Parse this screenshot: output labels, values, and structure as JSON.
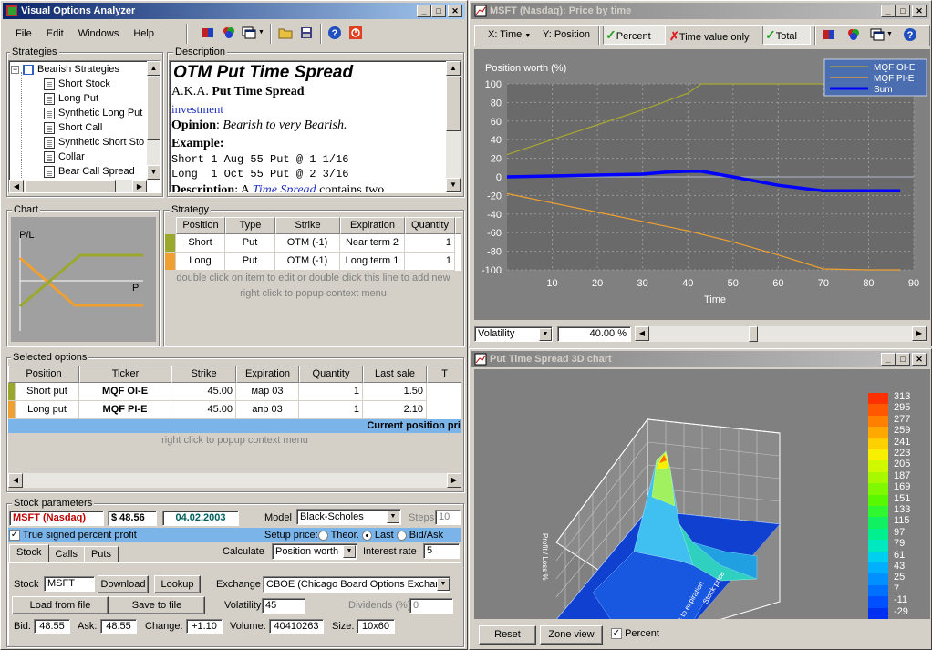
{
  "main": {
    "title": "Visual Options Analyzer",
    "menu": [
      "File",
      "Edit",
      "Windows",
      "Help"
    ]
  },
  "strategies": {
    "label": "Strategies",
    "root": "Bearish Strategies",
    "items": [
      "Short Stock",
      "Long Put",
      "Synthetic Long Put",
      "Short Call",
      "Synthetic Short Sto",
      "Collar",
      "Bear Call Spread"
    ]
  },
  "description": {
    "label": "Description",
    "heading": "OTM Put Time Spread",
    "aka_prefix": "A.K.A.",
    "aka": "Put Time Spread",
    "link": "investment",
    "opinion_label": "Opinion",
    "opinion": "Bearish to very Bearish.",
    "example_label": "Example:",
    "example_1": "Short 1 Aug 55 Put @ 1 1/16",
    "example_2": "Long  1 Oct 55 Put @ 2 3/16",
    "desc_label": "Description",
    "desc_prefix": ": A",
    "desc_link": "Time Spread",
    "desc_rest": "contains two"
  },
  "chart": {
    "label": "Chart",
    "pl": "P/L",
    "p": "P"
  },
  "strategy": {
    "label": "Strategy",
    "headers": [
      "Position",
      "Type",
      "Strike",
      "Expiration",
      "Quantity"
    ],
    "rows": [
      {
        "color": "#9aa82c",
        "cells": [
          "Short",
          "Put",
          "OTM (-1)",
          "Near term 2",
          "1"
        ]
      },
      {
        "color": "#f0a030",
        "cells": [
          "Long",
          "Put",
          "OTM (-1)",
          "Long term 1",
          "1"
        ]
      }
    ],
    "hint1": "double click on item to edit or double click this line to add new",
    "hint2": "right click to popup context menu"
  },
  "selected": {
    "label": "Selected options",
    "headers": [
      "Position",
      "Ticker",
      "Strike",
      "Expiration",
      "Quantity",
      "Last sale",
      "T"
    ],
    "rows": [
      {
        "color": "#9aa82c",
        "cells": [
          "Short put",
          "MQF OI-E",
          "45.00",
          "мар 03",
          "1",
          "1.50"
        ]
      },
      {
        "color": "#f0a030",
        "cells": [
          "Long put",
          "MQF PI-E",
          "45.00",
          "апр 03",
          "1",
          "2.10"
        ]
      }
    ],
    "current": "Current position pri",
    "hint": "right click to popup context menu"
  },
  "stock": {
    "label": "Stock parameters",
    "symbol": "MSFT (Nasdaq)",
    "price": "$ 48.56",
    "date": "04.02.2003",
    "model_label": "Model",
    "model": "Black-Scholes",
    "steps_label": "Steps",
    "steps": "10",
    "true_signed": "True signed percent profit",
    "setup_label": "Setup price:",
    "theor": "Theor.",
    "last": "Last",
    "bidask": "Bid/Ask",
    "tabs": [
      "Stock",
      "Calls",
      "Puts"
    ],
    "calc_label": "Calculate",
    "calc": "Position worth",
    "rate_label": "Interest rate",
    "rate": "5",
    "stock_label": "Stock",
    "stock_value": "MSFT",
    "download": "Download",
    "lookup": "Lookup",
    "exchange_label": "Exchange",
    "exchange": "CBOE (Chicago Board Options Exchang",
    "load": "Load from file",
    "save": "Save to file",
    "vol_label": "Volatility",
    "vol": "45",
    "div_label": "Dividends (%)",
    "div": "0",
    "bid_label": "Bid:",
    "bid": "48.55",
    "ask_label": "Ask:",
    "ask": "48.55",
    "change_label": "Change:",
    "change": "+1.10",
    "volume_label": "Volume:",
    "volume": "40410263",
    "size_label": "Size:",
    "size": "10x60"
  },
  "pricewin": {
    "title": "MSFT (Nasdaq): Price by time",
    "xsel": "X: Time",
    "ysel": "Y: Position",
    "percent": "Percent",
    "tvo": "Time value only",
    "total": "Total",
    "vol_sel": "Volatility",
    "vol_val": "40.00 %"
  },
  "chart_data": {
    "type": "line",
    "title": "",
    "ylabel": "Position worth (%)",
    "xlabel": "Time",
    "xlim": [
      0,
      90
    ],
    "ylim": [
      -100,
      100
    ],
    "xticks": [
      10,
      20,
      30,
      40,
      50,
      60,
      70,
      80,
      90
    ],
    "yticks": [
      100,
      80,
      60,
      40,
      20,
      0,
      -20,
      -40,
      -60,
      -80,
      -100
    ],
    "grid": true,
    "legend": "top-right",
    "series": [
      {
        "name": "MQF OI-E",
        "color": "#a8a830",
        "x": [
          0,
          10,
          20,
          30,
          40,
          43,
          50,
          60,
          70,
          80,
          87
        ],
        "y": [
          24,
          40,
          56,
          72,
          90,
          100,
          100,
          100,
          100,
          100,
          100
        ]
      },
      {
        "name": "MQF PI-E",
        "color": "#f0a030",
        "x": [
          0,
          10,
          20,
          30,
          40,
          50,
          60,
          70,
          80,
          87
        ],
        "y": [
          -18,
          -28,
          -38,
          -48,
          -58,
          -70,
          -84,
          -99,
          -100,
          -100
        ]
      },
      {
        "name": "Sum",
        "color": "#0000ff",
        "x": [
          0,
          10,
          20,
          30,
          35,
          40,
          43,
          50,
          60,
          70,
          80,
          87
        ],
        "y": [
          0,
          1,
          2,
          3,
          5,
          6,
          6,
          0,
          -9,
          -15,
          -15,
          -15
        ]
      }
    ]
  },
  "win3d": {
    "title": "Put Time Spread 3D chart",
    "reset": "Reset",
    "zone": "Zone view",
    "percent": "Percent",
    "scale": [
      "313",
      "295",
      "277",
      "259",
      "241",
      "223",
      "205",
      "187",
      "169",
      "151",
      "133",
      "115",
      "97",
      "79",
      "61",
      "43",
      "25",
      "7",
      "-11",
      "-29"
    ],
    "scale_colors": [
      "#ff3000",
      "#ff5800",
      "#ff8000",
      "#ffa800",
      "#ffd000",
      "#f8f000",
      "#d0f800",
      "#a8f800",
      "#80f800",
      "#58f800",
      "#30f830",
      "#10f060",
      "#00f090",
      "#00e8c0",
      "#00d0f0",
      "#00b0ff",
      "#0090ff",
      "#0070ff",
      "#0050ff",
      "#0030f0"
    ]
  }
}
